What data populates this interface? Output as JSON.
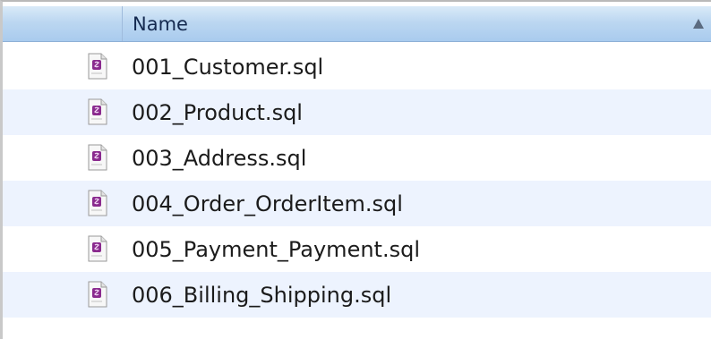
{
  "list": {
    "column_header": "Name",
    "sort_direction": "ascending",
    "files": [
      {
        "name": "001_Customer.sql",
        "icon": "sql-file-icon"
      },
      {
        "name": "002_Product.sql",
        "icon": "sql-file-icon"
      },
      {
        "name": "003_Address.sql",
        "icon": "sql-file-icon"
      },
      {
        "name": "004_Order_OrderItem.sql",
        "icon": "sql-file-icon"
      },
      {
        "name": "005_Payment_Payment.sql",
        "icon": "sql-file-icon"
      },
      {
        "name": "006_Billing_Shipping.sql",
        "icon": "sql-file-icon"
      }
    ]
  },
  "colors": {
    "header_gradient_top": "#d9eaf8",
    "header_gradient_bottom": "#a9cbee",
    "alt_row": "#edf3fe",
    "icon_accent": "#8a2a8e"
  }
}
